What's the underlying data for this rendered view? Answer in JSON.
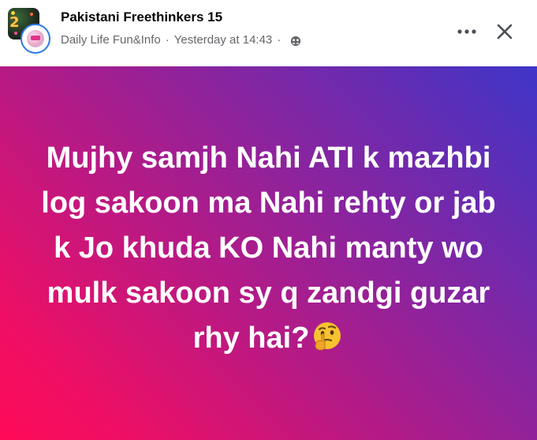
{
  "post_header": {
    "group_name": "Pakistani Freethinkers 15",
    "author_name": "Daily Life Fun&Info",
    "separator": "·",
    "timestamp": "Yesterday at 14:43",
    "audience_icon": "group-audience-icon",
    "group_avatar_text": "2"
  },
  "actions": {
    "more_icon": "more-horizontal-icon",
    "more_glyph": "•••",
    "close_icon": "close-icon"
  },
  "post": {
    "background_colors": [
      "#ff0a58",
      "#b51a86",
      "#7c27a6",
      "#3f35c8"
    ],
    "text_color": "#ffffff",
    "text": "Mujhy samjh Nahi ATI k mazhbi log sakoon ma Nahi rehty or jab k Jo khuda KO Nahi manty wo mulk sakoon sy q zandgi guzar rhy hai?",
    "emoji": "thinking-face-icon"
  }
}
